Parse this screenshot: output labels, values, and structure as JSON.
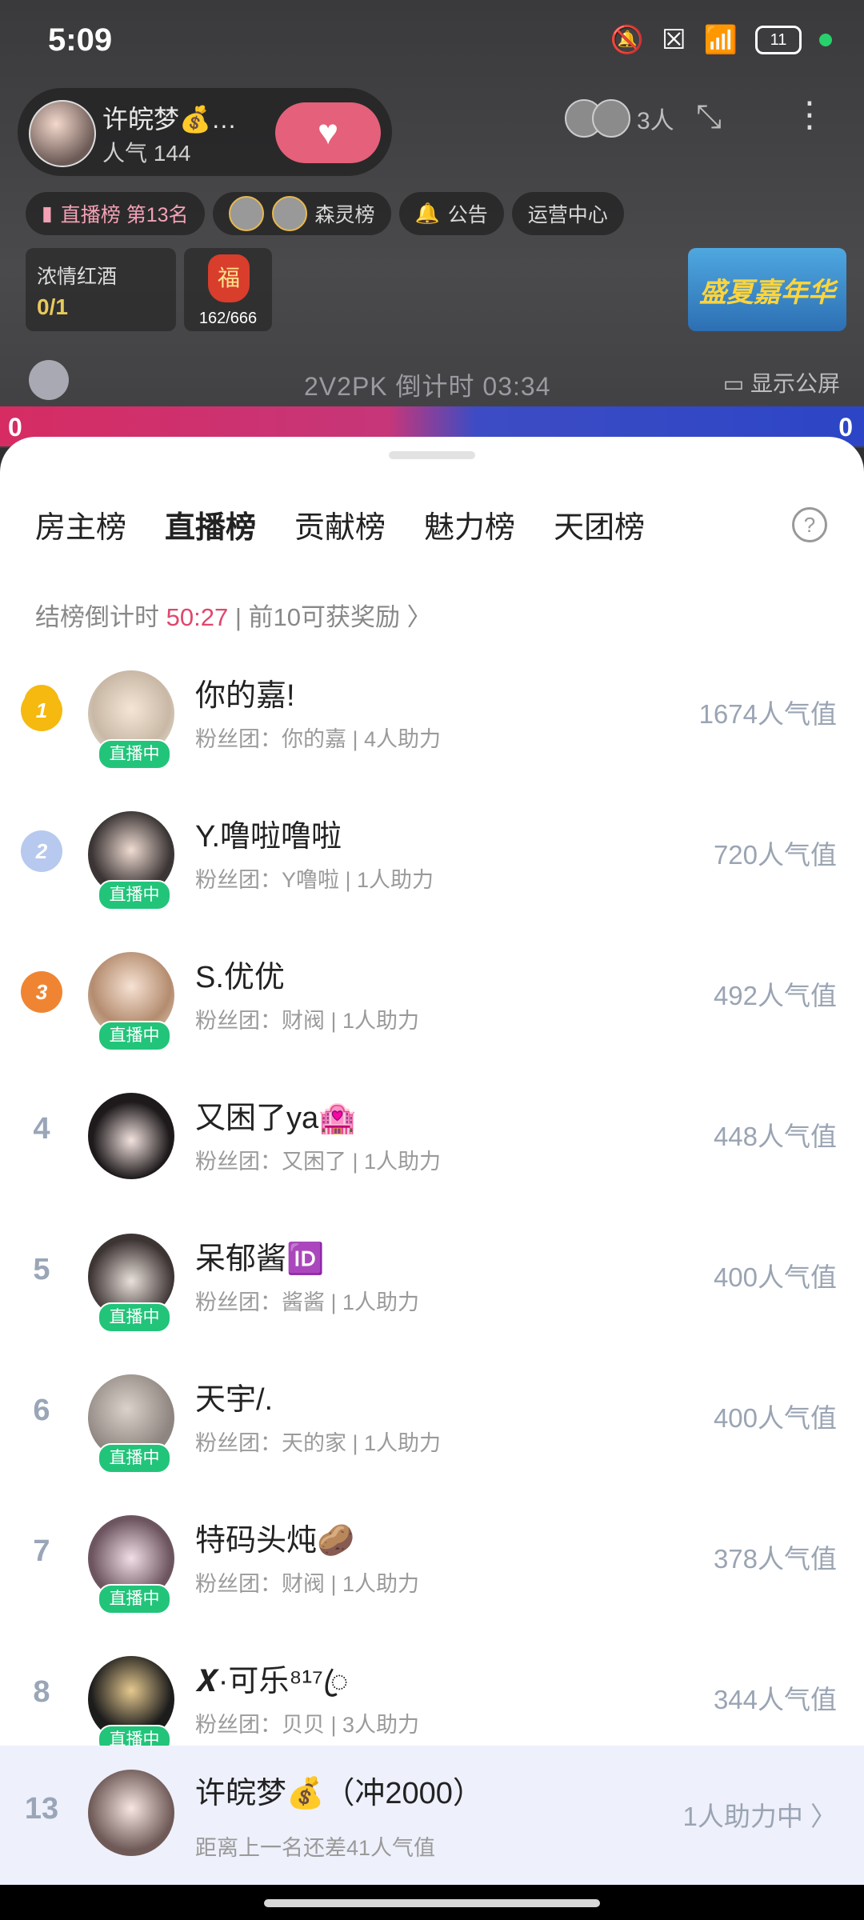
{
  "status_bar": {
    "time": "5:09",
    "battery": "11"
  },
  "room": {
    "host_name": "许皖梦💰…",
    "popularity": "人气 144",
    "viewers": "3人",
    "chips": [
      "直播榜 第13名",
      "森灵榜",
      "公告",
      "运营中心"
    ],
    "tile_wine": {
      "title": "浓情红酒",
      "count": "0/1"
    },
    "tile_fuku": {
      "glyph": "福",
      "count": "162/666"
    },
    "banner": "盛夏嘉年华",
    "pk_text": "2V2PK 倒计时 03:34",
    "screen_label": "显示公屏",
    "pk_left": "0",
    "pk_right": "0"
  },
  "sheet": {
    "tabs": [
      "房主榜",
      "直播榜",
      "贡献榜",
      "魅力榜",
      "天团榜"
    ],
    "active_tab": "直播榜",
    "help": "?",
    "countdown_label": "结榜倒计时",
    "countdown_time": "50:27",
    "reward_text": "| 前10可获奖励 〉",
    "ranking": [
      {
        "rank": "1",
        "name": "你的嘉!",
        "fans": "粉丝团：你的嘉 | 4人助力",
        "value": "1674人气值",
        "live": "直播中"
      },
      {
        "rank": "2",
        "name": "Y.噜啦噜啦",
        "fans": "粉丝团：Y噜啦 | 1人助力",
        "value": "720人气值",
        "live": "直播中"
      },
      {
        "rank": "3",
        "name": "S.优优",
        "fans": "粉丝团：财阀 | 1人助力",
        "value": "492人气值",
        "live": "直播中"
      },
      {
        "rank": "4",
        "name": "又困了ya🏩",
        "fans": "粉丝团：又困了 | 1人助力",
        "value": "448人气值",
        "live": ""
      },
      {
        "rank": "5",
        "name": "呆郁酱🆔",
        "fans": "粉丝团：酱酱 | 1人助力",
        "value": "400人气值",
        "live": "直播中"
      },
      {
        "rank": "6",
        "name": "天宇/.",
        "fans": "粉丝团：天的家 | 1人助力",
        "value": "400人气值",
        "live": "直播中"
      },
      {
        "rank": "7",
        "name": "特码头炖🥔",
        "fans": "粉丝团：财阀 | 1人助力",
        "value": "378人气值",
        "live": "直播中"
      },
      {
        "rank": "8",
        "name": "𝑿·可乐⁸¹⁷ꦿ",
        "fans": "粉丝团：贝贝 | 3人助力",
        "value": "344人气值",
        "live": "直播中"
      }
    ],
    "mine": {
      "rank": "13",
      "name": "许皖梦💰（冲2000）",
      "sub": "距离上一名还差41人气值",
      "value": "1人助力中 〉"
    }
  }
}
